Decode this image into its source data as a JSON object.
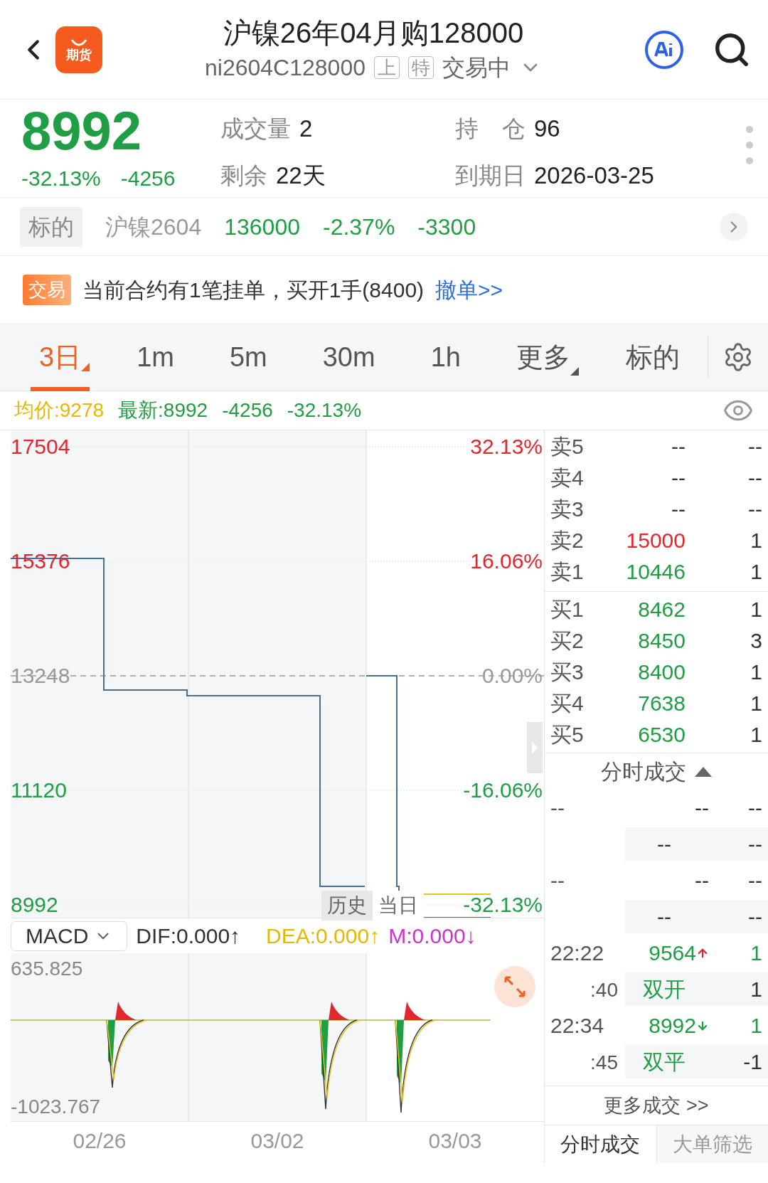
{
  "header": {
    "logo_text": "期货",
    "title": "沪镍26年04月购128000",
    "code": "ni2604C128000",
    "tags": [
      "上",
      "特"
    ],
    "status": "交易中"
  },
  "quote": {
    "price": "8992",
    "change_pct": "-32.13%",
    "change": "-4256",
    "stats": [
      {
        "label": "成交量",
        "value": "2"
      },
      {
        "label": "持　仓",
        "value": "96"
      },
      {
        "label": "剩余",
        "value": "22天"
      },
      {
        "label": "到期日",
        "value": "2026-03-25"
      }
    ]
  },
  "underlying": {
    "tag": "标的",
    "name": "沪镍2604",
    "price": "136000",
    "change_pct": "-2.37%",
    "change": "-3300"
  },
  "notice": {
    "tag": "交易",
    "text": "当前合约有1笔挂单，买开1手(8400)",
    "link": "撤单>>"
  },
  "tabs": [
    {
      "label": "3日",
      "selected": true,
      "has_menu": true
    },
    {
      "label": "1m",
      "selected": false,
      "has_menu": false
    },
    {
      "label": "5m",
      "selected": false,
      "has_menu": false
    },
    {
      "label": "30m",
      "selected": false,
      "has_menu": false
    },
    {
      "label": "1h",
      "selected": false,
      "has_menu": false
    },
    {
      "label": "更多",
      "selected": false,
      "has_menu": true
    },
    {
      "label": "标的",
      "selected": false,
      "has_menu": false
    }
  ],
  "info_line": {
    "avg": "均价:9278",
    "latest": "最新:8992",
    "change": "-4256",
    "change_pct": "-32.13%"
  },
  "price_chart": {
    "price_labels": [
      "17504",
      "15376",
      "13248",
      "11120",
      "8992"
    ],
    "percent_labels": [
      "32.13%",
      "16.06%",
      "0.00%",
      "-16.06%",
      "-32.13%"
    ],
    "toggle": [
      {
        "label": "历史",
        "selected": true
      },
      {
        "label": "当日",
        "selected": false
      }
    ]
  },
  "macd": {
    "indicator": "MACD",
    "dif": "DIF:0.000↑",
    "dea": "DEA:0.000↑",
    "m": "M:0.000↓",
    "scale_labels": [
      "635.825",
      "-1023.767"
    ],
    "dates": [
      "02/26",
      "03/02",
      "03/03"
    ]
  },
  "order_book": {
    "asks": [
      {
        "label": "卖5",
        "price": "--",
        "volume": "--",
        "color": "#333333"
      },
      {
        "label": "卖4",
        "price": "--",
        "volume": "--",
        "color": "#333333"
      },
      {
        "label": "卖3",
        "price": "--",
        "volume": "--",
        "color": "#333333"
      },
      {
        "label": "卖2",
        "price": "15000",
        "volume": "1",
        "color": "#e0282e"
      },
      {
        "label": "卖1",
        "price": "10446",
        "volume": "1",
        "color": "#1f9e43"
      }
    ],
    "bids": [
      {
        "label": "买1",
        "price": "8462",
        "volume": "1",
        "color": "#1f9e43"
      },
      {
        "label": "买2",
        "price": "8450",
        "volume": "3",
        "color": "#1f9e43"
      },
      {
        "label": "买3",
        "price": "8400",
        "volume": "1",
        "color": "#1f9e43"
      },
      {
        "label": "买4",
        "price": "7638",
        "volume": "1",
        "color": "#1f9e43"
      },
      {
        "label": "买5",
        "price": "6530",
        "volume": "1",
        "color": "#1f9e43"
      }
    ]
  },
  "trades": {
    "title": "分时成交",
    "items": [
      {
        "kind": "empty",
        "time": "--",
        "price": "--",
        "volume": "--",
        "type": "--",
        "type_volume": "--"
      },
      {
        "kind": "empty",
        "time": "--",
        "price": "--",
        "volume": "--",
        "type": "--",
        "type_volume": "--"
      },
      {
        "kind": "up",
        "time": "22:22",
        "price": "9564",
        "volume": "1",
        "sub_time": ":40",
        "type": "双开",
        "type_volume": "1"
      },
      {
        "kind": "down",
        "time": "22:34",
        "price": "8992",
        "volume": "1",
        "sub_time": ":45",
        "type": "双平",
        "type_volume": "-1"
      }
    ],
    "more": "更多成交 >>"
  },
  "bottom_tabs": [
    {
      "label": "分时成交",
      "selected": true
    },
    {
      "label": "大单筛选",
      "selected": false
    }
  ]
}
